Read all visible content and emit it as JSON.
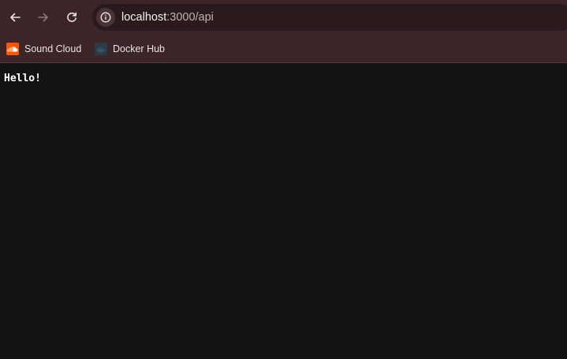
{
  "toolbar": {
    "back_icon": "arrow-left-icon",
    "forward_icon": "arrow-right-icon",
    "reload_icon": "reload-icon",
    "site_info_icon": "info-icon"
  },
  "address_bar": {
    "host": "localhost",
    "path": ":3000/api"
  },
  "bookmarks": [
    {
      "label": "Sound Cloud",
      "icon": "soundcloud-icon",
      "color": "#ff5500"
    },
    {
      "label": "Docker Hub",
      "icon": "docker-icon",
      "color": "#2d3a47"
    }
  ],
  "page": {
    "body_text": "Hello!"
  },
  "colors": {
    "chrome": "#3b2529",
    "omnibox": "#2a1a1e",
    "page_background": "#131313"
  }
}
